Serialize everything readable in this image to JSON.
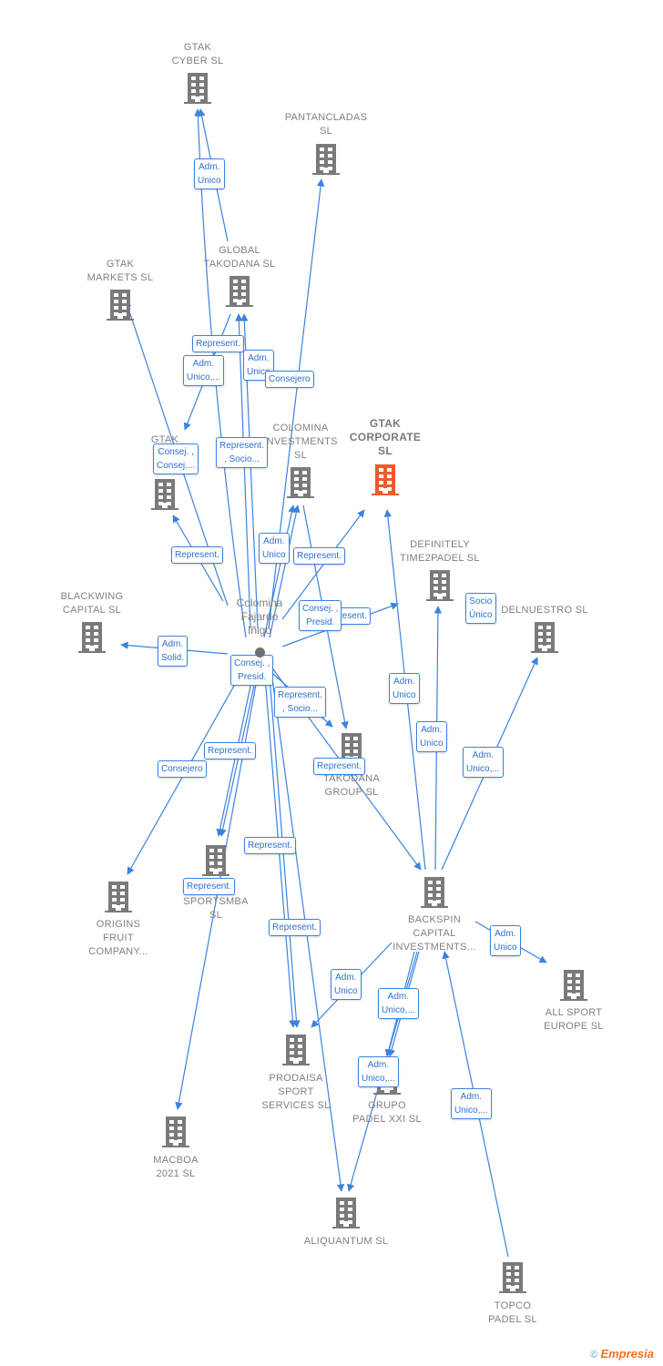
{
  "colors": {
    "edge": "#3b82e0",
    "node": "#7a7a7a",
    "focus": "#f05a28"
  },
  "person": {
    "name": "Colomina\nFajardo\nIñigo"
  },
  "nodes": [
    {
      "label": "GTAK\nCYBER  SL"
    },
    {
      "label": "PANTANCLADAS\nSL"
    },
    {
      "label": "GLOBAL\nTAKODANA  SL"
    },
    {
      "label": "GTAK\nMARKETS  SL"
    },
    {
      "label": "GTAK\nINVE"
    },
    {
      "label": "COLOMINA\nINVESTMENTS\nSL"
    },
    {
      "label": "GTAK\nCORPORATE\nSL",
      "focus": true
    },
    {
      "label": "DEFINITELY\nTIME2PADEL SL"
    },
    {
      "label": "DELNUESTRO SL"
    },
    {
      "label": "BLACKWING\nCAPITAL  SL"
    },
    {
      "label": "TAKODANA\nGROUP  SL"
    },
    {
      "label": "SPORTSMBA\nSL"
    },
    {
      "label": "ORIGINS\nFRUIT\nCOMPANY..."
    },
    {
      "label": "BACKSPIN\nCAPITAL\nINVESTMENTS..."
    },
    {
      "label": "ALL SPORT\nEUROPE  SL"
    },
    {
      "label": "PRODAISA\nSPORT\nSERVICES  SL"
    },
    {
      "label": "GRUPO\nPADEL XXI  SL"
    },
    {
      "label": "MACBOA\n2021  SL"
    },
    {
      "label": "ALIQUANTUM SL"
    },
    {
      "label": "TOPCO\nPADEL  SL"
    }
  ],
  "edge_labels": [
    "Adm.\nUnico",
    "Represent.",
    "Adm.\nUnico,...",
    "Adm.\nUnico",
    "Consejero",
    "Consej. ,\nConsej....",
    "Represent.\n, Socio...",
    "Represent.",
    "Adm.\nUnico",
    "Represent.",
    "Represent.",
    "Consej. ,\nPresid.",
    "Socio\nÚnico",
    "Adm.\nSolid.",
    "Consej. ,\nPresid.",
    "Represent.\n, Socio...",
    "Adm.\nUnico",
    "Adm.\nUnico",
    "Represent.",
    "Consejero",
    "Represent.",
    "Adm.\nUnico,...",
    "Represent.",
    "Represent.",
    "Represent.",
    "Adm.\nUnico",
    "Adm.\nUnico",
    "Adm.\nUnico,...",
    "Adm.\nUnico,...",
    "Adm.\nUnico,..."
  ],
  "brand": {
    "copyright": "©",
    "name": "Empresia"
  }
}
